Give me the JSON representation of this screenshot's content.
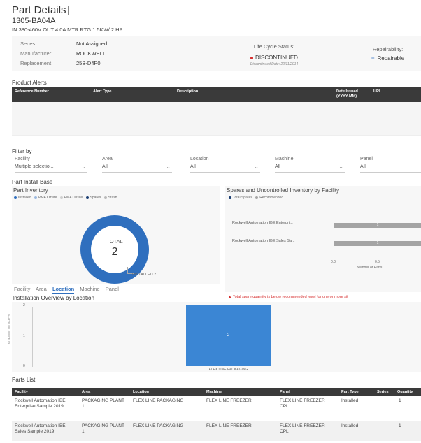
{
  "header": {
    "title": "Part Details",
    "part_number": "1305-BA04A",
    "description": "IN 380-460V OUT 4.0A MTR RTG:1.5KW/ 2 HP"
  },
  "info": {
    "series_label": "Series",
    "series_value": "Not Assigned",
    "manufacturer_label": "Manufacturer",
    "manufacturer_value": "ROCKWELL",
    "replacement_label": "Replacement",
    "replacement_value": "25B-D4P0",
    "lifecycle_label": "Life Cycle Status:",
    "lifecycle_value": "DISCONTINUED",
    "lifecycle_date": "Discontinued Date: 20/11/2014",
    "repairability_label": "Repairability:",
    "repairability_value": "Repairable",
    "status_color": "#d62d2d"
  },
  "alerts": {
    "title": "Product Alerts",
    "columns": [
      "Reference Number",
      "Alert Type",
      "Description",
      "Date Issued (YYYY-MM)",
      "URL"
    ]
  },
  "filters": {
    "title": "Filter by",
    "items": [
      {
        "label": "Facility",
        "value": "Multiple selectio..."
      },
      {
        "label": "Area",
        "value": "All"
      },
      {
        "label": "Location",
        "value": "All"
      },
      {
        "label": "Machine",
        "value": "All"
      },
      {
        "label": "Panel",
        "value": "All"
      }
    ]
  },
  "install_base": {
    "title": "Part Install Base"
  },
  "inventory": {
    "title": "Part Inventory",
    "legend": [
      "Installed",
      "PMA Offsite",
      "PMA Onsite",
      "Spares",
      "Stash"
    ],
    "total_label": "TOTAL",
    "total_value": "2",
    "callout": "INSTALLED 2"
  },
  "spares": {
    "title": "Spares and Uncontrolled Inventory by Facility",
    "legend": [
      "Total Spares",
      "Recommended"
    ],
    "warning": "▲ Total spare quantity is below recommended level for one or more sit"
  },
  "tabs": {
    "items": [
      "Facility",
      "Area",
      "Location",
      "Machine",
      "Panel"
    ],
    "active": "Location"
  },
  "overview": {
    "title": "Installation Overview by Location"
  },
  "chart_data": [
    {
      "type": "bar",
      "orientation": "horizontal",
      "categories": [
        "Rockwell Automation IBE Enterpri...",
        "Rockwell Automation IBE Sales Sa..."
      ],
      "values": [
        1,
        1
      ],
      "xlabel": "Number of Parts",
      "ticks": [
        "0.0",
        "0.5"
      ]
    },
    {
      "type": "bar",
      "categories": [
        "FLEX LINE PACKAGING"
      ],
      "values": [
        2
      ],
      "ylabel": "NUMBER OF PARTS",
      "ylim": [
        0,
        2
      ],
      "ticks": [
        "2",
        "1",
        "0"
      ]
    }
  ],
  "parts_list": {
    "title": "Parts List",
    "columns": [
      "Facility",
      "Area",
      "Location",
      "Machine",
      "Panel",
      "Part Type",
      "Series",
      "Quantity"
    ],
    "rows": [
      [
        "Rockwell Automation IBE Enterprise Sample 2019",
        "PACKAGING PLANT 1",
        "FLEX LINE PACKAGING",
        "FLEX LINE FREEZER",
        "FLEX LINE FREEZER CPL",
        "Installed",
        "",
        "1"
      ],
      [
        "Rockwell Automation IBE Sales Sample 2019",
        "PACKAGING PLANT 1",
        "FLEX LINE PACKAGING",
        "FLEX LINE FREEZER",
        "FLEX LINE FREEZER CPL",
        "Installed",
        "",
        "1"
      ]
    ]
  }
}
